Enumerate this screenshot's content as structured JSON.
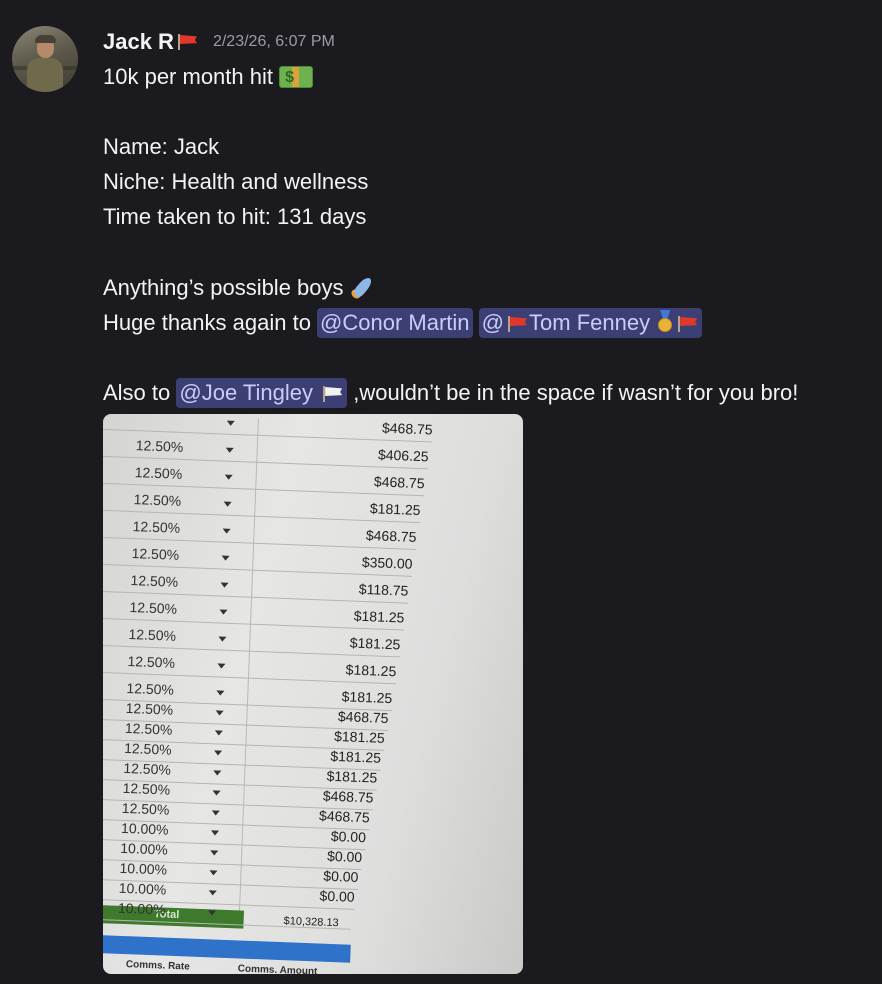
{
  "message": {
    "author": "Jack R",
    "timestamp": "2/23/26, 6:07 PM",
    "lines": {
      "l1": "10k per month hit",
      "l2": "Name: Jack",
      "l3": "Niche: Health and wellness",
      "l4": "Time taken to hit: 131 days",
      "l5": "Anything’s possible boys",
      "l6_prefix": "Huge thanks again to ",
      "l7_prefix": "Also to ",
      "l7_suffix": " ,wouldn’t be in the space if wasn’t for you bro!"
    },
    "mentions": {
      "conor": "@Conor Martin",
      "tom_at": "@",
      "tom_name": "Tom Fenney",
      "joe": "@Joe Tingley"
    },
    "icons": [
      "money-emoji",
      "rocket-emoji",
      "red-flag-emoji",
      "medal-emoji",
      "white-flag-emoji"
    ]
  },
  "attachment": {
    "rows": [
      {
        "rate": "",
        "amount": "$468.75"
      },
      {
        "rate": "12.50%",
        "amount": "$406.25"
      },
      {
        "rate": "12.50%",
        "amount": "$468.75"
      },
      {
        "rate": "12.50%",
        "amount": "$181.25"
      },
      {
        "rate": "12.50%",
        "amount": "$468.75"
      },
      {
        "rate": "12.50%",
        "amount": "$350.00"
      },
      {
        "rate": "12.50%",
        "amount": "$118.75"
      },
      {
        "rate": "12.50%",
        "amount": "$181.25"
      },
      {
        "rate": "12.50%",
        "amount": "$181.25"
      },
      {
        "rate": "12.50%",
        "amount": "$181.25"
      },
      {
        "rate": "12.50%",
        "amount": "$181.25"
      },
      {
        "rate": "12.50%",
        "amount": "$468.75"
      },
      {
        "rate": "12.50%",
        "amount": "$181.25"
      },
      {
        "rate": "12.50%",
        "amount": "$181.25"
      },
      {
        "rate": "12.50%",
        "amount": "$181.25"
      },
      {
        "rate": "12.50%",
        "amount": "$468.75"
      },
      {
        "rate": "12.50%",
        "amount": "$468.75"
      },
      {
        "rate": "10.00%",
        "amount": "$0.00"
      },
      {
        "rate": "10.00%",
        "amount": "$0.00"
      },
      {
        "rate": "10.00%",
        "amount": "$0.00"
      },
      {
        "rate": "10.00%",
        "amount": "$0.00"
      },
      {
        "rate": "10.00%",
        "amount": ""
      }
    ],
    "total_label": "Total",
    "total_amount": "$10,328.13",
    "footer_headers": [
      "Comms. Rate",
      "Comms. Amount"
    ],
    "colors": {
      "total_bar": "#3d7a2c",
      "header_bar": "#2f72c9"
    }
  }
}
